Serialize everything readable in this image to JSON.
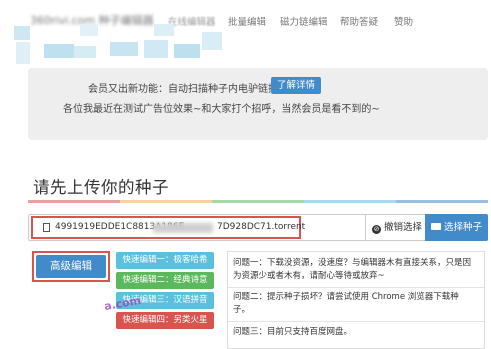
{
  "nav": {
    "brand": "360rivi.com 种子编辑器",
    "links": [
      "在线编辑器",
      "批量编辑",
      "磁力链编辑",
      "帮助答疑",
      "赞助"
    ]
  },
  "notice": {
    "line1": "会员又出新功能：自动扫描种子内电驴链接",
    "learn_more": "了解详情",
    "line2": "各位我最近在测试广告位效果~和大家打个招呼，当然会员是看不到的~"
  },
  "upload": {
    "title": "请先上传你的种子",
    "file_name_prefix": "4991919EDDE1C8813A186E",
    "file_name_suffix": "7D928DC71.torrent",
    "cancel_label": "撤销选择",
    "select_label": "选择种子"
  },
  "advanced_edit_label": "高级编辑",
  "modes": [
    {
      "label": "快速编辑一：极客哈希",
      "color": "#5bc0de"
    },
    {
      "label": "快速编辑二：经典诗意",
      "color": "#5cb85c"
    },
    {
      "label": "快速编辑三：汉语拼音",
      "color": "#5bc0de"
    },
    {
      "label": "快速编辑四：另类火星",
      "color": "#d9534f"
    }
  ],
  "faq": {
    "q1_line1": "问题一：下载没资源，没速度？与编辑器木有直接关系，只是因",
    "q1_line2": "为资源少或者木有，请耐心等待或放弃~",
    "q2_line1": "问题二：提示种子损坏？请尝试使用 Chrome 浏览器下载种",
    "q2_line2": "子。",
    "q3_line1": "问题三：目前只支持百度网盘。"
  },
  "watermark": "a.com"
}
